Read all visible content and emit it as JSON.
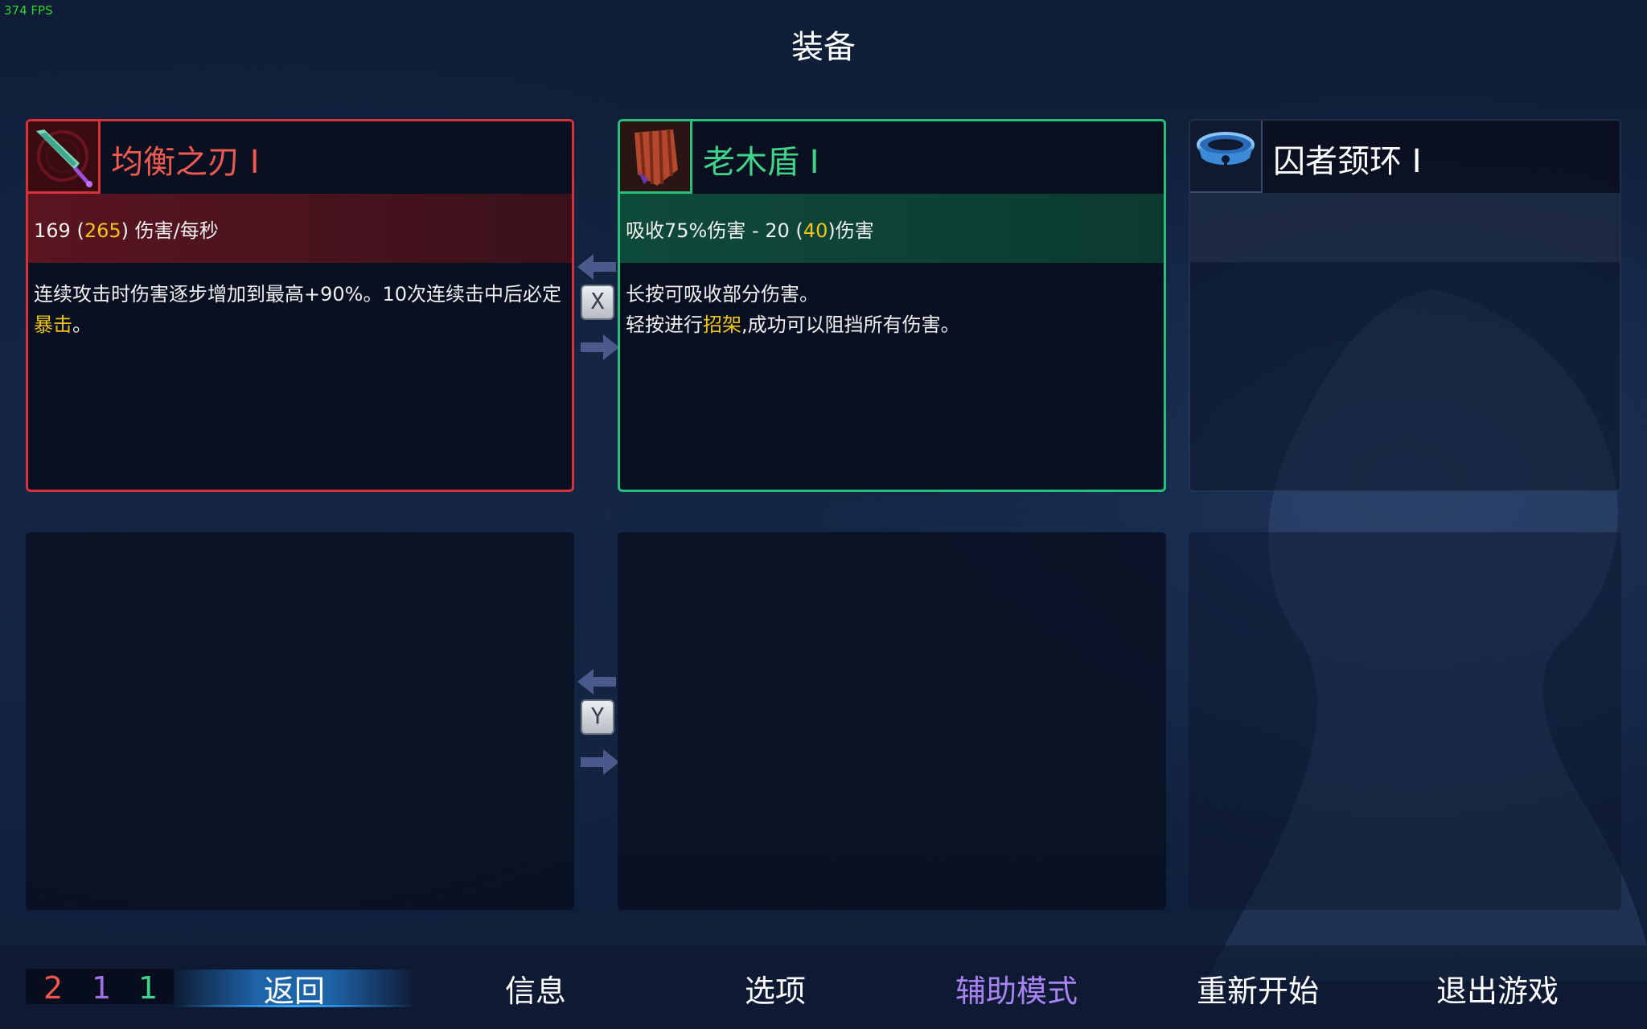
{
  "fps": "374 FPS",
  "title": "装备",
  "cards": {
    "weapon1": {
      "name": "均衡之刃 I",
      "stat_a": "169 (",
      "stat_hl": "265",
      "stat_b": ") 伤害/每秒",
      "desc_a": "连续攻击时伤害逐步增加到最高+90%。10次连续击中后必定",
      "desc_hl": "暴击",
      "desc_b": "。",
      "border_color": "#d9313a"
    },
    "weapon2": {
      "name": "老木盾 I",
      "stat_a": "吸收75%伤害 - 20 (",
      "stat_hl": "40",
      "stat_b": ")伤害",
      "desc_line1": "长按可吸收部分伤害。",
      "desc_a": "轻按进行",
      "desc_hl": "招架",
      "desc_b": ",成功可以阻挡所有伤害。",
      "border_color": "#27c07a"
    },
    "amulet": {
      "name": "囚者颈环 I"
    }
  },
  "swap_keys": {
    "top": "X",
    "bottom": "Y"
  },
  "counters": {
    "red": "2",
    "purple": "1",
    "green": "1",
    "colors": {
      "red": "#f0564e",
      "purple": "#a070e8",
      "green": "#3ed58a"
    }
  },
  "menu": {
    "back": "返回",
    "info": "信息",
    "options": "选项",
    "assist": "辅助模式",
    "restart": "重新开始",
    "quit": "退出游戏"
  }
}
